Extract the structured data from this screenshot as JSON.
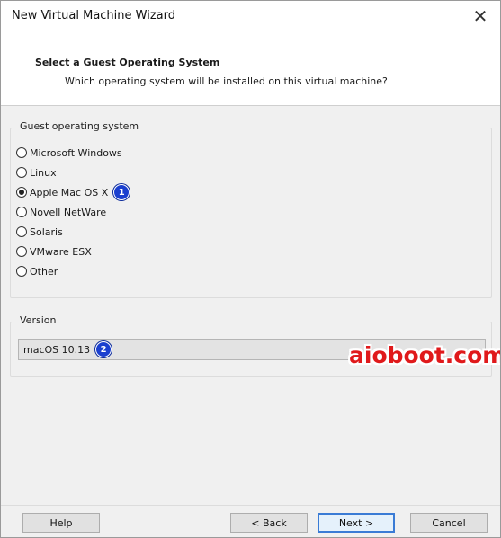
{
  "window": {
    "title": "New Virtual Machine Wizard",
    "close_icon": "close-icon"
  },
  "header": {
    "title": "Select a Guest Operating System",
    "subtitle": "Which operating system will be installed on this virtual machine?"
  },
  "guest_os": {
    "legend": "Guest operating system",
    "options": [
      {
        "label": "Microsoft Windows",
        "selected": false
      },
      {
        "label": "Linux",
        "selected": false
      },
      {
        "label": "Apple Mac OS X",
        "selected": true,
        "step_badge": "1"
      },
      {
        "label": "Novell NetWare",
        "selected": false
      },
      {
        "label": "Solaris",
        "selected": false
      },
      {
        "label": "VMware ESX",
        "selected": false
      },
      {
        "label": "Other",
        "selected": false
      }
    ]
  },
  "version": {
    "legend": "Version",
    "selected_value": "macOS 10.13",
    "step_badge": "2"
  },
  "watermark": "aioboot.com",
  "buttons": {
    "help": "Help",
    "back": "< Back",
    "next": "Next >",
    "cancel": "Cancel"
  },
  "colors": {
    "badge": "#1a3fcf",
    "watermark": "#e0191b",
    "default_button_border": "#3a7bd5"
  }
}
